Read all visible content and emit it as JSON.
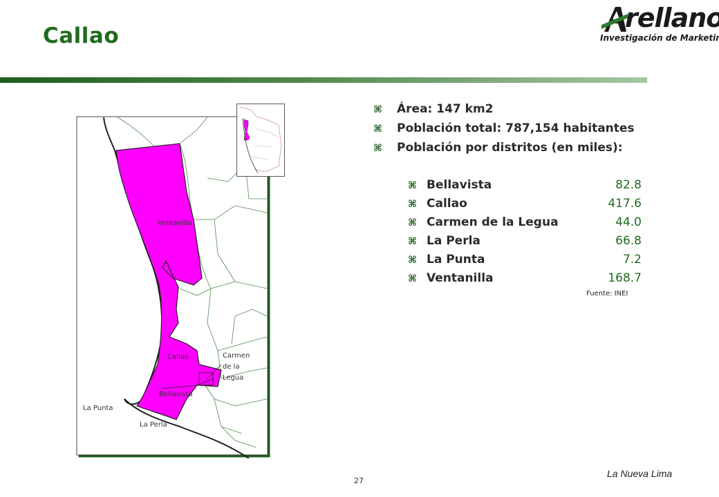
{
  "page": {
    "title": "Callao",
    "page_number": "27",
    "footer": "La Nueva Lima",
    "source": "Fuente: INEI"
  },
  "logo": {
    "wordmark": "rellano",
    "tagline": "Investigación de Marketing"
  },
  "facts": [
    "Área: 147 km2",
    "Población total: 787,154 habitantes",
    "Población por distritos (en miles):"
  ],
  "districts": [
    {
      "name": "Bellavista",
      "value": "82.8"
    },
    {
      "name": "Callao",
      "value": "417.6"
    },
    {
      "name": "Carmen de la Legua",
      "value": "44.0"
    },
    {
      "name": "La Perla",
      "value": "66.8"
    },
    {
      "name": "La Punta",
      "value": "7.2"
    },
    {
      "name": "Ventanilla",
      "value": "168.7"
    }
  ],
  "map": {
    "labels": {
      "ventanilla": "Ventanilla",
      "callao": "Callao",
      "carmen_1": "Carmen",
      "carmen_2": "de la",
      "carmen_3": "Legua",
      "bellavista": "Bellavista",
      "la_punta": "La Punta",
      "la_perla": "La Perla"
    },
    "highlight_color": "#ff00ff",
    "line_color": "#2e6b2e"
  },
  "colors": {
    "title": "#1f6b1f",
    "bullet": "#1f5c1f",
    "value": "#1f6b1f"
  }
}
